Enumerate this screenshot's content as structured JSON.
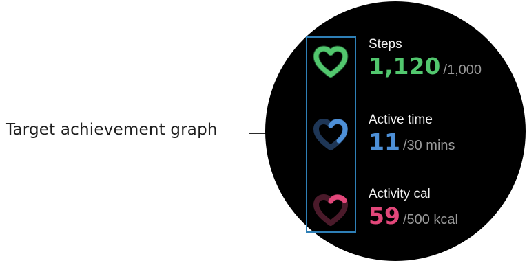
{
  "callout": {
    "label": "Target achievement graph"
  },
  "stats": {
    "steps": {
      "title": "Steps",
      "value": "1,120",
      "target": "/1,000",
      "color": "#52c76e",
      "icon": "heart-ring-icon",
      "progress": 1.0
    },
    "active_time": {
      "title": "Active time",
      "value": "11",
      "target": "/30 mins",
      "color": "#4d8fd6",
      "icon": "heart-ring-icon",
      "progress": 0.37
    },
    "activity_cal": {
      "title": "Activity cal",
      "value": "59",
      "target": "/500 kcal",
      "color": "#e2477a",
      "icon": "heart-ring-icon",
      "progress": 0.12
    }
  },
  "colors": {
    "highlight_box": "#2e7fb6",
    "watch_background": "#000000"
  }
}
